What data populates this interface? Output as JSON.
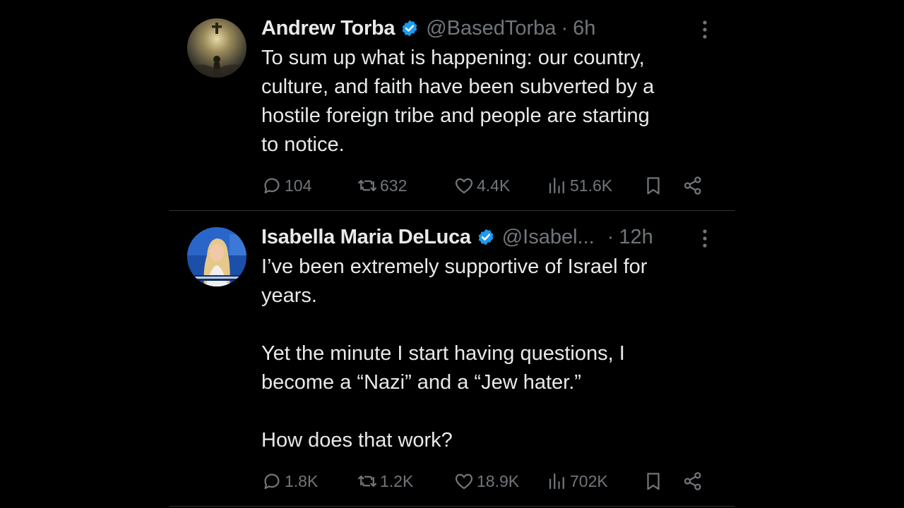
{
  "theme": {
    "background": "#000000",
    "text": "#e7e9ea",
    "muted": "#71767b",
    "verified": "#1d9bf0"
  },
  "tweets": [
    {
      "name": "Andrew Torba",
      "handle": "@BasedTorba",
      "separator": "·",
      "time": "6h",
      "text": "To sum up what is happening: our country,\nculture, and faith have been subverted by a\nhostile foreign tribe and people are starting\nto notice.",
      "replies": "104",
      "reposts": "632",
      "likes": "4.4K",
      "views": "51.6K",
      "avatar_icon": "hooded-figure-avatar"
    },
    {
      "name": "Isabella Maria DeLuca",
      "handle": "@Isabel...",
      "separator": "·",
      "time": "12h",
      "text": "I’ve been extremely supportive of Israel for\nyears.\n\nYet the minute I start having questions, I\nbecome a “Nazi” and a “Jew hater.”\n\nHow does that work?",
      "replies": "1.8K",
      "reposts": "1.2K",
      "likes": "18.9K",
      "views": "702K",
      "avatar_icon": "news-anchor-avatar"
    }
  ]
}
